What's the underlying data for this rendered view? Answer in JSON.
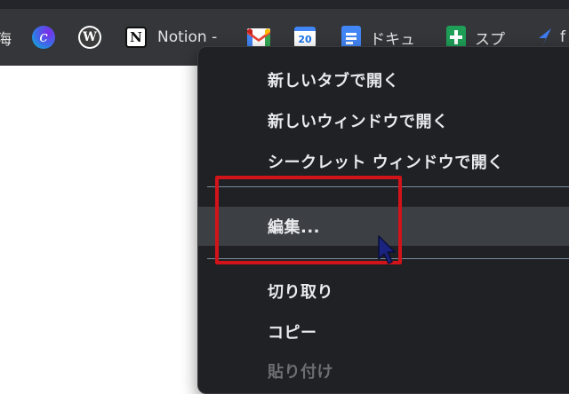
{
  "bookmarks_bar": {
    "partial_left": "海",
    "items": [
      {
        "icon": "canva-icon",
        "label": ""
      },
      {
        "icon": "wordpress-icon",
        "label": ""
      },
      {
        "icon": "notion-icon",
        "label": "Notion -"
      },
      {
        "icon": "gmail-icon",
        "label": ""
      },
      {
        "icon": "google-calendar-icon",
        "label": "",
        "icon_text": "20"
      },
      {
        "icon": "google-docs-icon",
        "label": "ドキュ"
      },
      {
        "icon": "google-sheets-icon",
        "label": "スプ"
      },
      {
        "icon": "blue-arrow-icon",
        "label": "f"
      }
    ]
  },
  "context_menu": {
    "items": [
      {
        "label": "新しいタブで開く",
        "state": "normal"
      },
      {
        "label": "新しいウィンドウで開く",
        "state": "normal"
      },
      {
        "label": "シークレット ウィンドウで開く",
        "state": "normal"
      },
      {
        "label": "編集...",
        "state": "highlighted"
      },
      {
        "label": "切り取り",
        "state": "normal"
      },
      {
        "label": "コピー",
        "state": "normal"
      },
      {
        "label": "貼り付け",
        "state": "disabled"
      }
    ]
  },
  "colors": {
    "bookmarks_bar_bg": "#35363a",
    "menu_bg": "#202124",
    "menu_highlight": "#3c3f44",
    "annotation_box": "#d0141a",
    "cursor": "#1a237e"
  }
}
